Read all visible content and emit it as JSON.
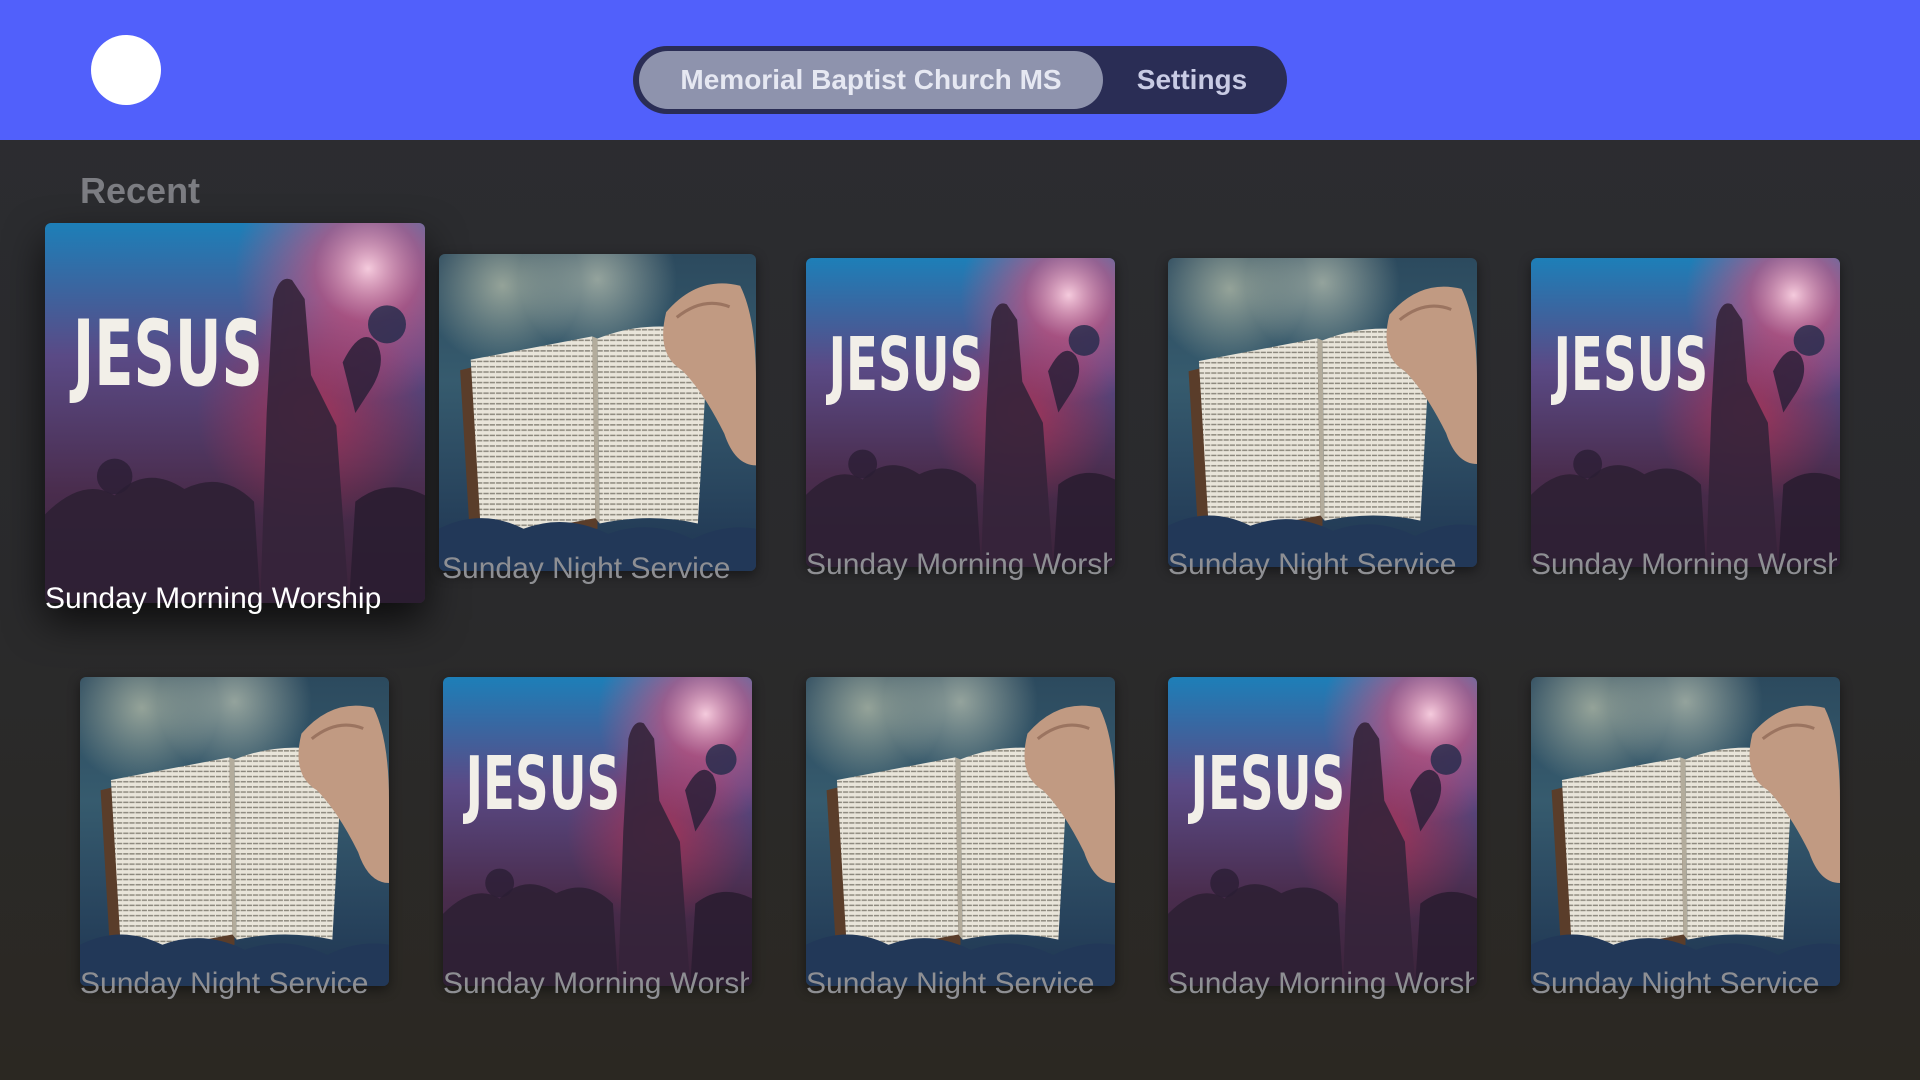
{
  "header": {
    "tabs": [
      {
        "label": "Memorial Baptist Church MS",
        "active": true
      },
      {
        "label": "Settings",
        "active": false
      }
    ],
    "accent_color": "#5160fb"
  },
  "section": {
    "title": "Recent"
  },
  "items": [
    {
      "title": "Sunday Morning Worship",
      "art": "jesus-worship-image"
    },
    {
      "title": "Sunday Night Service",
      "art": "open-bible-image"
    },
    {
      "title": "Sunday Morning Worship",
      "art": "jesus-worship-image"
    },
    {
      "title": "Sunday Night Service",
      "art": "open-bible-image"
    },
    {
      "title": "Sunday Morning Worship",
      "art": "jesus-worship-image"
    },
    {
      "title": "Sunday Night Service",
      "art": "open-bible-image"
    },
    {
      "title": "Sunday Morning Worship",
      "art": "jesus-worship-image"
    },
    {
      "title": "Sunday Night Service",
      "art": "open-bible-image"
    },
    {
      "title": "Sunday Morning Worship",
      "art": "jesus-worship-image"
    },
    {
      "title": "Sunday Night Service",
      "art": "open-bible-image"
    }
  ],
  "art_text": {
    "jesus": "JESUS"
  }
}
